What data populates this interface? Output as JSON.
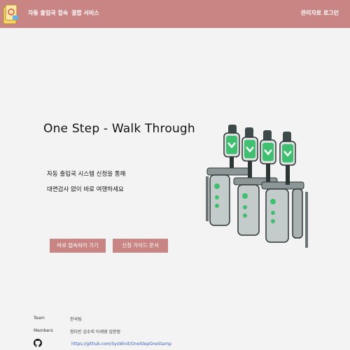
{
  "navbar": {
    "logo_icon": "passport-stamp-logo-icon",
    "links": [
      "자동 출입국 접속",
      "결합 서비스"
    ],
    "login_label": "관리자로 로그인",
    "bg_color": "#c98584"
  },
  "hero": {
    "title": "One Step - Walk Through",
    "desc_line1": "자동 출입국 시스템 신청을 통해",
    "desc_line2": "대면검사 없이 바로 여행하세요",
    "start_button": "바로 접속하러 가기",
    "guide_button": "신청 가이드 문서",
    "illustration_icon": "automated-gate-illustration"
  },
  "footer": {
    "team_label": "Team",
    "team_value": "한국팀",
    "members_label": "Members",
    "members_value": "정다빈 김수지 이세영 임현정",
    "github_icon": "github-icon",
    "github_link": "https://github.com/SysWinit/OneStepOneStamp"
  }
}
